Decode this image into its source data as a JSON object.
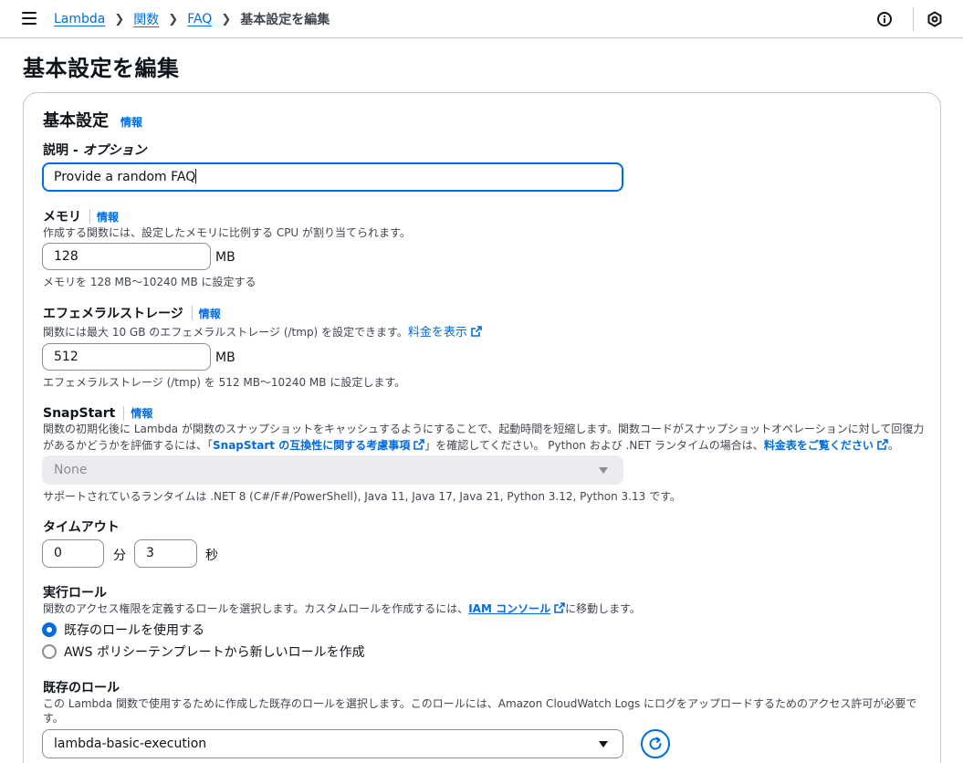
{
  "breadcrumb": {
    "items": [
      "Lambda",
      "関数",
      "FAQ"
    ],
    "current": "基本設定を編集"
  },
  "page_title": "基本設定を編集",
  "section": {
    "title": "基本設定",
    "info": "情報"
  },
  "description_field": {
    "label": "説明 - ",
    "optional": "オプション",
    "value": "Provide a random FAQ"
  },
  "memory": {
    "label": "メモリ",
    "info": "情報",
    "description": "作成する関数には、設定したメモリに比例する CPU が割り当てられます。",
    "value": "128",
    "unit": "MB",
    "constraint": "メモリを 128 MB～10240 MB に設定する"
  },
  "ephemeral": {
    "label": "エフェメラルストレージ",
    "info": "情報",
    "description": "関数には最大 10 GB のエフェメラルストレージ (/tmp) を設定できます。",
    "pricing_link": "料金を表示",
    "value": "512",
    "unit": "MB",
    "constraint": "エフェメラルストレージ (/tmp) を 512 MB～10240 MB に設定します。"
  },
  "snapstart": {
    "label": "SnapStart",
    "info": "情報",
    "description_line1": "関数の初期化後に Lambda が関数のスナップショットをキャッシュするようにすることで、起動時間を短縮します。関数コードがスナップショットオペレーションに対して回復力",
    "description_line2_pre": "があるかどうかを評価するには、「",
    "compat_link": "SnapStart の互換性に関する考慮事項",
    "description_line2_mid": "」を確認してください。 Python および .NET ランタイムの場合は、",
    "pricing_link": "料金表をご覧ください",
    "description_line2_post": "。",
    "selected": "None",
    "runtimes_note": "サポートされているランタイムは .NET 8 (C#/F#/PowerShell), Java 11, Java 17, Java 21, Python 3.12, Python 3.13 です。"
  },
  "timeout": {
    "label": "タイムアウト",
    "minutes": "0",
    "minutes_unit": "分",
    "seconds": "3",
    "seconds_unit": "秒"
  },
  "role": {
    "label": "実行ロール",
    "description_pre": "関数のアクセス権限を定義するロールを選択します。カスタムロールを作成するには、",
    "iam_link": "IAM コンソール",
    "description_post": "に移動します。",
    "options": [
      "既存のロールを使用する",
      "AWS ポリシーテンプレートから新しいロールを作成"
    ],
    "selected_index": 0
  },
  "existing_role": {
    "label": "既存のロール",
    "description": "この Lambda 関数で使用するために作成した既存のロールを選択します。このロールには、Amazon CloudWatch Logs にログをアップロードするためのアクセス許可が必要で",
    "description_line2": "す。",
    "selected": "lambda-basic-execution"
  },
  "colors": {
    "accent": "#006ce0",
    "text": "#0f141a",
    "muted": "#424650",
    "border": "#8c8c94"
  }
}
